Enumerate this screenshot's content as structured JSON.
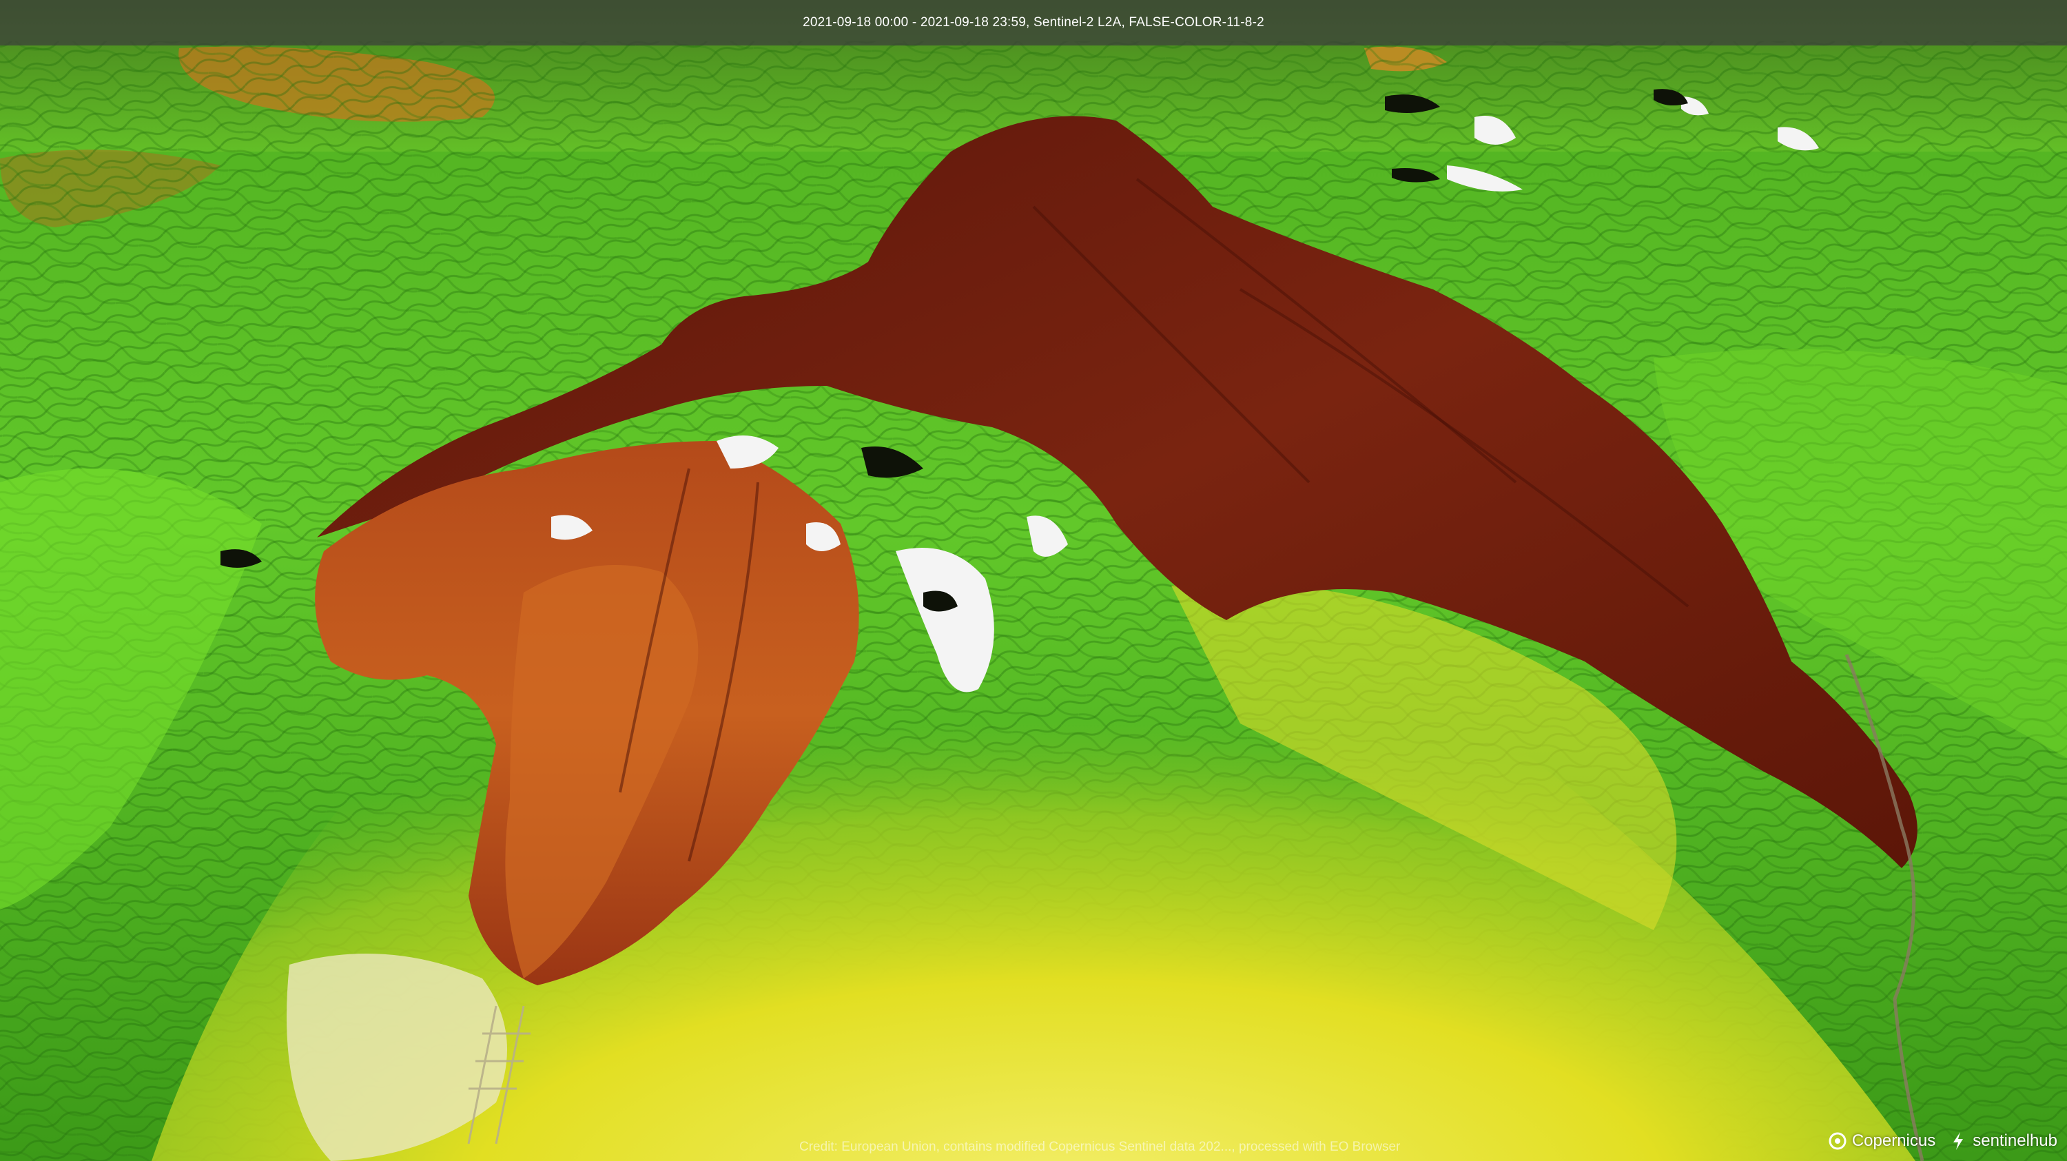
{
  "header": {
    "title": "2021-09-18 00:00 - 2021-09-18 23:59, Sentinel-2 L2A, FALSE-COLOR-11-8-2"
  },
  "footer": {
    "attribution": "Credit: European Union, contains modified Copernicus Sentinel data 202..., processed with EO Browser"
  },
  "logos": {
    "copernicus": "Copernicus",
    "sentinelhub": "sentinelhub"
  },
  "colors": {
    "vegetation_bright": "#5fd12a",
    "vegetation_dark": "#2f8a12",
    "dry_terrain": "#e6e22a",
    "burn_scar_dark": "#6e1a0c",
    "burn_scar_orange": "#c4531e",
    "snow_cloud": "#f4f4f4",
    "title_bar": "#3c3c3c"
  }
}
